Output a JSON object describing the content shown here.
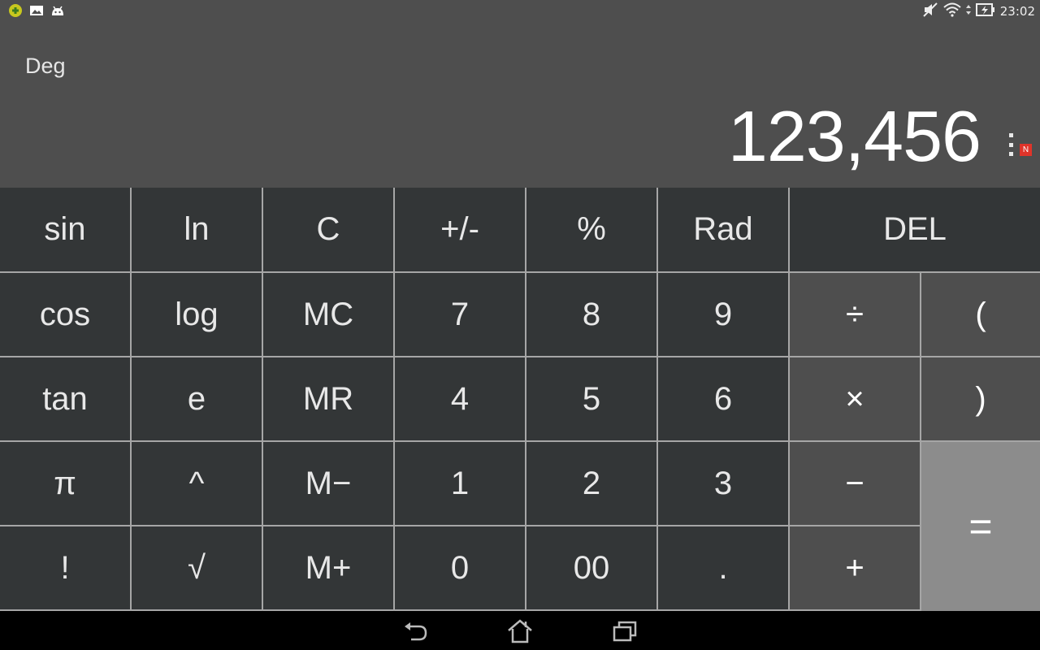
{
  "status_bar": {
    "left_icons": [
      "app-notification-icon",
      "image-notification-icon",
      "android-notification-icon"
    ],
    "right_icons": [
      "mute-icon",
      "wifi-icon",
      "data-activity-icon",
      "battery-charging-icon"
    ],
    "time": "23:02"
  },
  "display": {
    "angle_mode": "Deg",
    "result": "123,456",
    "menu_icon": "overflow-menu-icon",
    "badge": "N"
  },
  "keypad": {
    "rows": [
      [
        "sin",
        "ln",
        "C",
        "+/-",
        "%",
        "Rad",
        "DEL"
      ],
      [
        "cos",
        "log",
        "MC",
        "7",
        "8",
        "9",
        "÷",
        "("
      ],
      [
        "tan",
        "e",
        "MR",
        "4",
        "5",
        "6",
        "×",
        ")"
      ],
      [
        "π",
        "^",
        "M−",
        "1",
        "2",
        "3",
        "−",
        "="
      ],
      [
        "!",
        "√",
        "M+",
        "0",
        "00",
        ".",
        "+"
      ]
    ]
  },
  "nav_bar": {
    "buttons": [
      "back-icon",
      "home-icon",
      "recent-apps-icon"
    ]
  },
  "colors": {
    "key_bg": "#333637",
    "operator_bg": "#4e4e4e",
    "equals_bg": "#8c8c8c",
    "grid_line": "#a6a6a6",
    "display_bg": "#4e4e4e",
    "badge": "#e0342a"
  }
}
